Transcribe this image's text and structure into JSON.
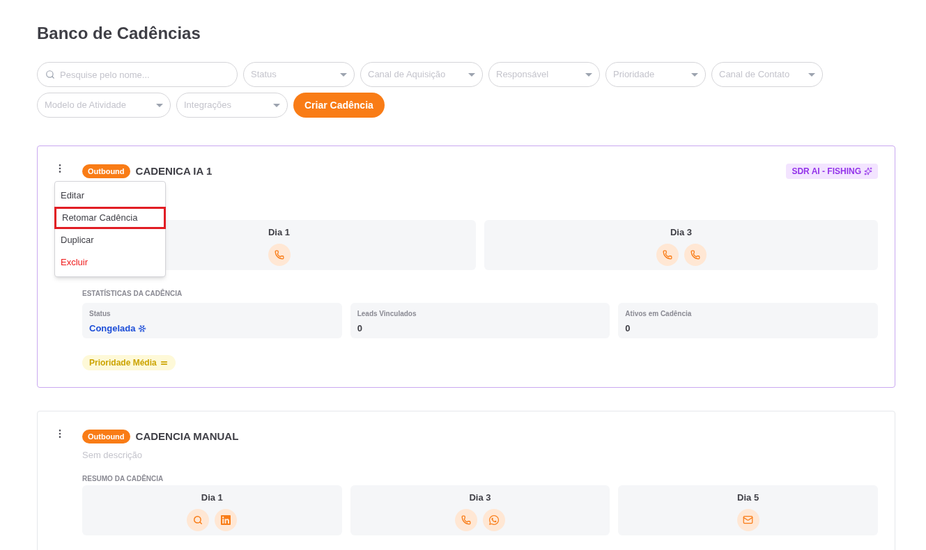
{
  "page_title": "Banco de Cadências",
  "filters": {
    "search": {
      "placeholder": "Pesquise pelo nome..."
    },
    "selects": [
      {
        "placeholder": "Status"
      },
      {
        "placeholder": "Canal de Aquisição"
      },
      {
        "placeholder": "Responsável"
      },
      {
        "placeholder": "Prioridade"
      },
      {
        "placeholder": "Canal de Contato"
      },
      {
        "placeholder": "Modelo de Atividade"
      },
      {
        "placeholder": "Integrações"
      }
    ],
    "create_button": "Criar Cadência"
  },
  "cadences": [
    {
      "type_badge": "Outbound",
      "name": "CADENICA IA 1",
      "ai_tag": "SDR AI - FISHING",
      "selected": true,
      "menu": {
        "items": [
          {
            "label": "Editar",
            "kind": "normal",
            "highlighted": false
          },
          {
            "label": "Retomar Cadência",
            "kind": "normal",
            "highlighted": true
          },
          {
            "label": "Duplicar",
            "kind": "normal",
            "highlighted": false
          },
          {
            "label": "Excluir",
            "kind": "danger",
            "highlighted": false
          }
        ]
      },
      "days": [
        {
          "label": "Dia 1",
          "activities": [
            {
              "kind": "phone"
            }
          ]
        },
        {
          "label": "Dia 3",
          "activities": [
            {
              "kind": "phone"
            },
            {
              "kind": "phone"
            }
          ]
        }
      ],
      "stats_label": "ESTATÍSTICAS DA CADÊNCIA",
      "stats": [
        {
          "label": "Status",
          "value": "Congelada",
          "kind": "frozen"
        },
        {
          "label": "Leads Vinculados",
          "value": "0",
          "kind": "plain"
        },
        {
          "label": "Ativos em Cadência",
          "value": "0",
          "kind": "plain"
        }
      ],
      "priority": "Prioridade Média"
    },
    {
      "type_badge": "Outbound",
      "name": "CADENCIA MANUAL",
      "description": "Sem descrição",
      "selected": false,
      "summary_label": "RESUMO DA CADÊNCIA",
      "days": [
        {
          "label": "Dia 1",
          "activities": [
            {
              "kind": "search"
            },
            {
              "kind": "linkedin"
            }
          ]
        },
        {
          "label": "Dia 3",
          "activities": [
            {
              "kind": "phone"
            },
            {
              "kind": "whatsapp"
            }
          ]
        },
        {
          "label": "Dia 5",
          "activities": [
            {
              "kind": "email"
            }
          ]
        }
      ]
    }
  ]
}
